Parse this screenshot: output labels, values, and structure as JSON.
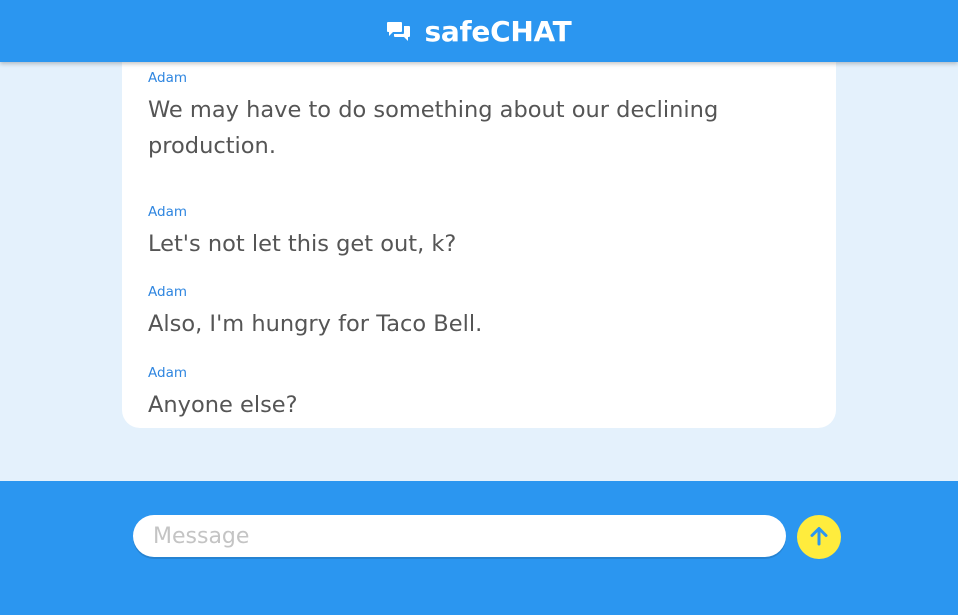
{
  "header": {
    "title": "safeCHAT",
    "icon": "chat-bubbles-icon"
  },
  "messages": [
    {
      "author": "Adam",
      "text": "We may have to do something about our declining production."
    },
    {
      "author": "Adam",
      "text": "Let's not let this get out, k?"
    },
    {
      "author": "Adam",
      "text": "Also, I'm hungry for Taco Bell."
    },
    {
      "author": "Adam",
      "text": "Anyone else?"
    }
  ],
  "composer": {
    "placeholder": "Message",
    "value": "",
    "send_icon": "arrow-up-icon"
  },
  "colors": {
    "primary": "#2b96f0",
    "background": "#e4f1fc",
    "author": "#2f86e0",
    "message_text": "#555555",
    "send_button": "#ffec3d",
    "send_arrow": "#2b96f0"
  }
}
